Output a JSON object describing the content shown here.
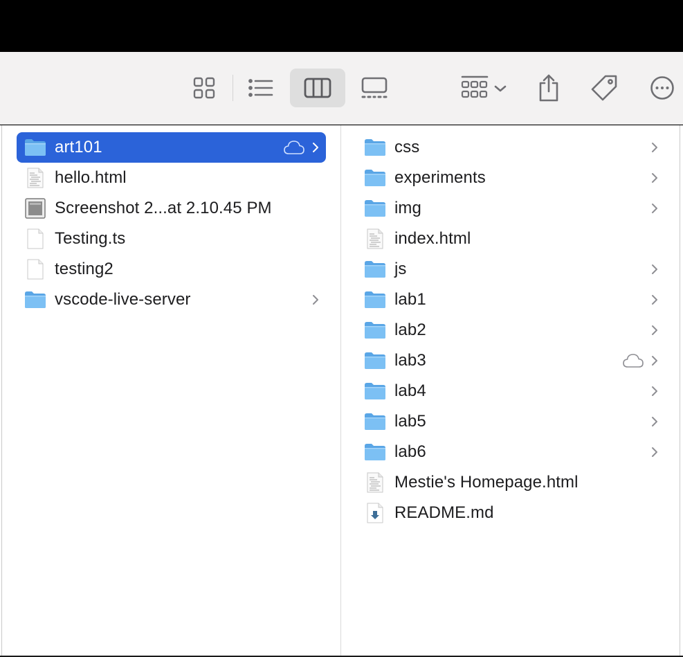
{
  "toolbar": {
    "buttons": [
      {
        "name": "icon-view-button",
        "icon": "grid-icon",
        "active": false
      },
      {
        "name": "list-view-button",
        "icon": "list-icon",
        "active": false
      },
      {
        "name": "column-view-button",
        "icon": "columns-icon",
        "active": true
      },
      {
        "name": "gallery-view-button",
        "icon": "gallery-icon",
        "active": false
      },
      {
        "name": "group-button",
        "icon": "group-icon",
        "active": false
      },
      {
        "name": "share-button",
        "icon": "share-icon",
        "active": false
      },
      {
        "name": "tags-button",
        "icon": "tag-icon",
        "active": false
      },
      {
        "name": "more-button",
        "icon": "ellipsis-icon",
        "active": false
      }
    ]
  },
  "columns": [
    {
      "items": [
        {
          "label": "art101",
          "type": "folder",
          "selected": true,
          "cloud": true,
          "chevron": true
        },
        {
          "label": "hello.html",
          "type": "html",
          "selected": false,
          "cloud": false,
          "chevron": false
        },
        {
          "label": "Screenshot 2...at 2.10.45 PM",
          "type": "image",
          "selected": false,
          "cloud": false,
          "chevron": false
        },
        {
          "label": "Testing.ts",
          "type": "blank",
          "selected": false,
          "cloud": false,
          "chevron": false
        },
        {
          "label": "testing2",
          "type": "blank",
          "selected": false,
          "cloud": false,
          "chevron": false
        },
        {
          "label": "vscode-live-server",
          "type": "folder",
          "selected": false,
          "cloud": false,
          "chevron": true
        }
      ]
    },
    {
      "items": [
        {
          "label": "css",
          "type": "folder",
          "cloud": false,
          "chevron": true
        },
        {
          "label": "experiments",
          "type": "folder",
          "cloud": false,
          "chevron": true
        },
        {
          "label": "img",
          "type": "folder",
          "cloud": false,
          "chevron": true
        },
        {
          "label": "index.html",
          "type": "html",
          "cloud": false,
          "chevron": false
        },
        {
          "label": "js",
          "type": "folder",
          "cloud": false,
          "chevron": true
        },
        {
          "label": "lab1",
          "type": "folder",
          "cloud": false,
          "chevron": true
        },
        {
          "label": "lab2",
          "type": "folder",
          "cloud": false,
          "chevron": true
        },
        {
          "label": "lab3",
          "type": "folder",
          "cloud": true,
          "chevron": true
        },
        {
          "label": "lab4",
          "type": "folder",
          "cloud": false,
          "chevron": true
        },
        {
          "label": "lab5",
          "type": "folder",
          "cloud": false,
          "chevron": true
        },
        {
          "label": "lab6",
          "type": "folder",
          "cloud": false,
          "chevron": true
        },
        {
          "label": "Mestie's Homepage.html",
          "type": "html",
          "cloud": false,
          "chevron": false
        },
        {
          "label": "README.md",
          "type": "markdown",
          "cloud": false,
          "chevron": false
        }
      ]
    }
  ],
  "colors": {
    "selection": "#2b63d9",
    "folder": "#6cb4ee",
    "toolbar_bg": "#f3f2f2"
  }
}
